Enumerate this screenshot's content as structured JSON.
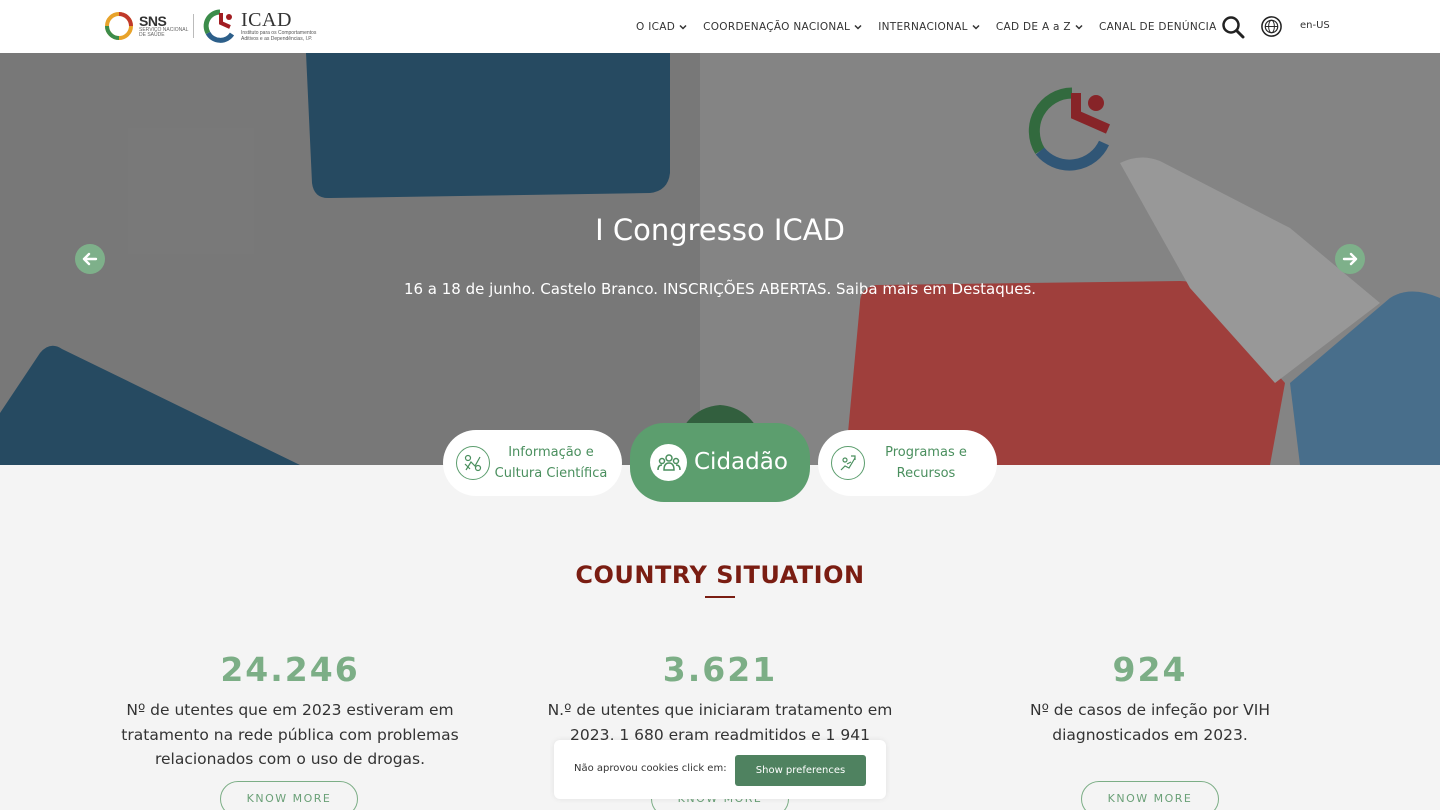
{
  "header": {
    "sns_logo": {
      "title": "SNS",
      "subtitle_1": "SERVIÇO NACIONAL",
      "subtitle_2": "DE SAÚDE"
    },
    "icad_logo": {
      "title": "ICAD",
      "subtitle_1": "Instituto para os Comportamentos",
      "subtitle_2": "Aditivos e as Dependências, I.P."
    },
    "nav": [
      {
        "label": "O ICAD",
        "dropdown": true
      },
      {
        "label": "COORDENAÇÃO NACIONAL",
        "dropdown": true
      },
      {
        "label": "INTERNACIONAL",
        "dropdown": true
      },
      {
        "label": "CAD DE A a Z",
        "dropdown": true
      },
      {
        "label": "CANAL DE DENÚNCIA",
        "dropdown": false
      }
    ],
    "search_icon": "search-icon",
    "globe_icon": "globe-icon",
    "language": "en-US"
  },
  "hero": {
    "title": "I Congresso ICAD",
    "subtitle": "16 a 18 de junho. Castelo Branco. INSCRIÇÕES ABERTAS. Saiba mais em Destaques."
  },
  "pills": {
    "left": {
      "line1": "Informação e",
      "line2": "Cultura Científica",
      "icon": "science-icon"
    },
    "mid": {
      "label": "Cidadão",
      "icon": "people-icon"
    },
    "right": {
      "line1": "Programas e",
      "line2": "Recursos",
      "icon": "resources-icon"
    }
  },
  "country_situation": {
    "title": "COUNTRY SITUATION",
    "stats": [
      {
        "value": "24.246",
        "description": "Nº de utentes que em 2023 estiveram em tratamento na rede pública com problemas relacionados com o uso de drogas.",
        "button": "KNOW MORE"
      },
      {
        "value": "3.621",
        "description": "N.º de utentes que iniciaram tratamento em 2023, 1 680 eram readmitidos e 1 941",
        "button": "KNOW MORE"
      },
      {
        "value": "924",
        "description": "Nº de casos de infeção por VIH diagnosticados em 2023.",
        "button": "KNOW MORE"
      }
    ]
  },
  "cookie": {
    "text": "Não aprovou cookies click em:",
    "button": "Show preferences"
  },
  "colors": {
    "green": "#5c9e6e",
    "stat_green": "#7cae86",
    "dark_red": "#7a1d12",
    "cookie_button": "#4f8260"
  }
}
